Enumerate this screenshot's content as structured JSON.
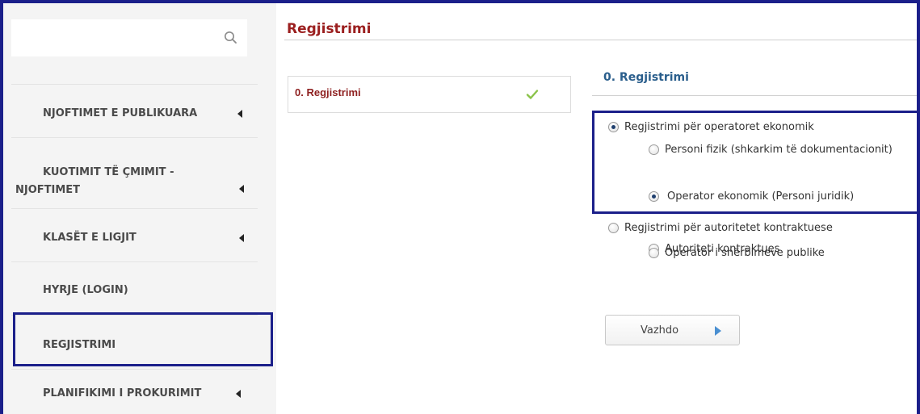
{
  "sidebar": {
    "search": {
      "value": "",
      "placeholder": "",
      "icon": "search-icon"
    },
    "items": [
      {
        "label": "NJOFTIMET E PUBLIKUARA",
        "has_arrow": true
      },
      {
        "label_line1": "KUOTIMIT TË ÇMIMIT -",
        "label_line2": "NJOFTIMET",
        "has_arrow": true
      },
      {
        "label": "KLASËT E LIGJIT",
        "has_arrow": true
      },
      {
        "label": "HYRJE (LOGIN)",
        "has_arrow": false
      },
      {
        "label": "REGJISTRIMI",
        "has_arrow": false,
        "highlighted": true
      },
      {
        "label": "PLANIFIKIMI I PROKURIMIT",
        "has_arrow": true
      }
    ]
  },
  "main": {
    "title": "Regjistrimi",
    "steps": [
      {
        "label": "0. Regjistrimi",
        "status_icon": "check-icon"
      }
    ],
    "section_title": "0. Regjistrimi",
    "options": {
      "economic_operators": {
        "label": "Regjistrimi për operatoret ekonomik",
        "checked": true
      },
      "natural_person": {
        "label": "Personi fizik (shkarkim të dokumentacionit)",
        "checked": false
      },
      "legal_person": {
        "label": "Operator ekonomik (Personi juridik)",
        "checked": true
      },
      "contracting_authorities": {
        "label": "Regjistrimi për autoritetet kontraktuese",
        "checked": false
      },
      "contracting_authority": {
        "label": "Autoriteti kontraktues",
        "checked": false
      },
      "public_services": {
        "label": "Operator i shërbimeve publike",
        "checked": false
      }
    },
    "continue_label": "Vazhdo"
  },
  "colors": {
    "highlight_border": "#1b1f8a",
    "title_red": "#9b1f1f",
    "section_blue": "#2a5e8c",
    "sidebar_bg": "#f4f4f4",
    "check_green": "#8bc34a",
    "arrow_blue": "#4a8fd1"
  }
}
